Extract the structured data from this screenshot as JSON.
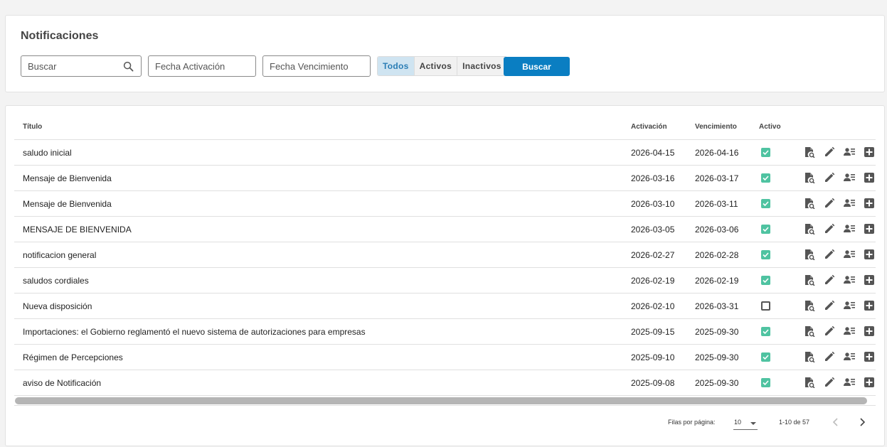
{
  "header": {
    "title": "Notificaciones"
  },
  "filters": {
    "search_placeholder": "Buscar",
    "activation_placeholder": "Fecha Activación",
    "expiry_placeholder": "Fecha Vencimiento",
    "status_options": [
      "Todos",
      "Activos",
      "Inactivos"
    ],
    "selected_status": "Todos",
    "search_button": "Buscar"
  },
  "table": {
    "columns": {
      "title": "Título",
      "activation": "Activación",
      "expiry": "Vencimiento",
      "active": "Activo"
    },
    "rows": [
      {
        "title": "saludo inicial",
        "activation": "2026-04-15",
        "expiry": "2026-04-16",
        "active": true
      },
      {
        "title": "Mensaje de Bienvenida",
        "activation": "2026-03-16",
        "expiry": "2026-03-17",
        "active": true
      },
      {
        "title": "Mensaje de Bienvenida",
        "activation": "2026-03-10",
        "expiry": "2026-03-11",
        "active": true
      },
      {
        "title": "MENSAJE DE BIENVENIDA",
        "activation": "2026-03-05",
        "expiry": "2026-03-06",
        "active": true
      },
      {
        "title": "notificacion general",
        "activation": "2026-02-27",
        "expiry": "2026-02-28",
        "active": true
      },
      {
        "title": "saludos cordiales",
        "activation": "2026-02-19",
        "expiry": "2026-02-19",
        "active": true
      },
      {
        "title": "Nueva disposición",
        "activation": "2026-02-10",
        "expiry": "2026-03-31",
        "active": false
      },
      {
        "title": "Importaciones: el Gobierno reglamentó el nuevo sistema de autorizaciones para empresas",
        "activation": "2025-09-15",
        "expiry": "2025-09-30",
        "active": true
      },
      {
        "title": "Régimen de Percepciones",
        "activation": "2025-09-10",
        "expiry": "2025-09-30",
        "active": true
      },
      {
        "title": "aviso de Notificación",
        "activation": "2025-09-08",
        "expiry": "2025-09-30",
        "active": true
      }
    ],
    "row_actions": [
      "view-document-icon",
      "edit-pencil-icon",
      "recipients-list-icon",
      "add-box-icon"
    ]
  },
  "pagination": {
    "rows_per_page_label": "Filas por página:",
    "rows_per_page": "10",
    "range": "1-10 de 57"
  },
  "colors": {
    "primary": "#0a7ec2",
    "active_check": "#4fc3a1",
    "segment_active_bg": "#cfe4f1",
    "segment_active_text": "#2a7db5"
  }
}
